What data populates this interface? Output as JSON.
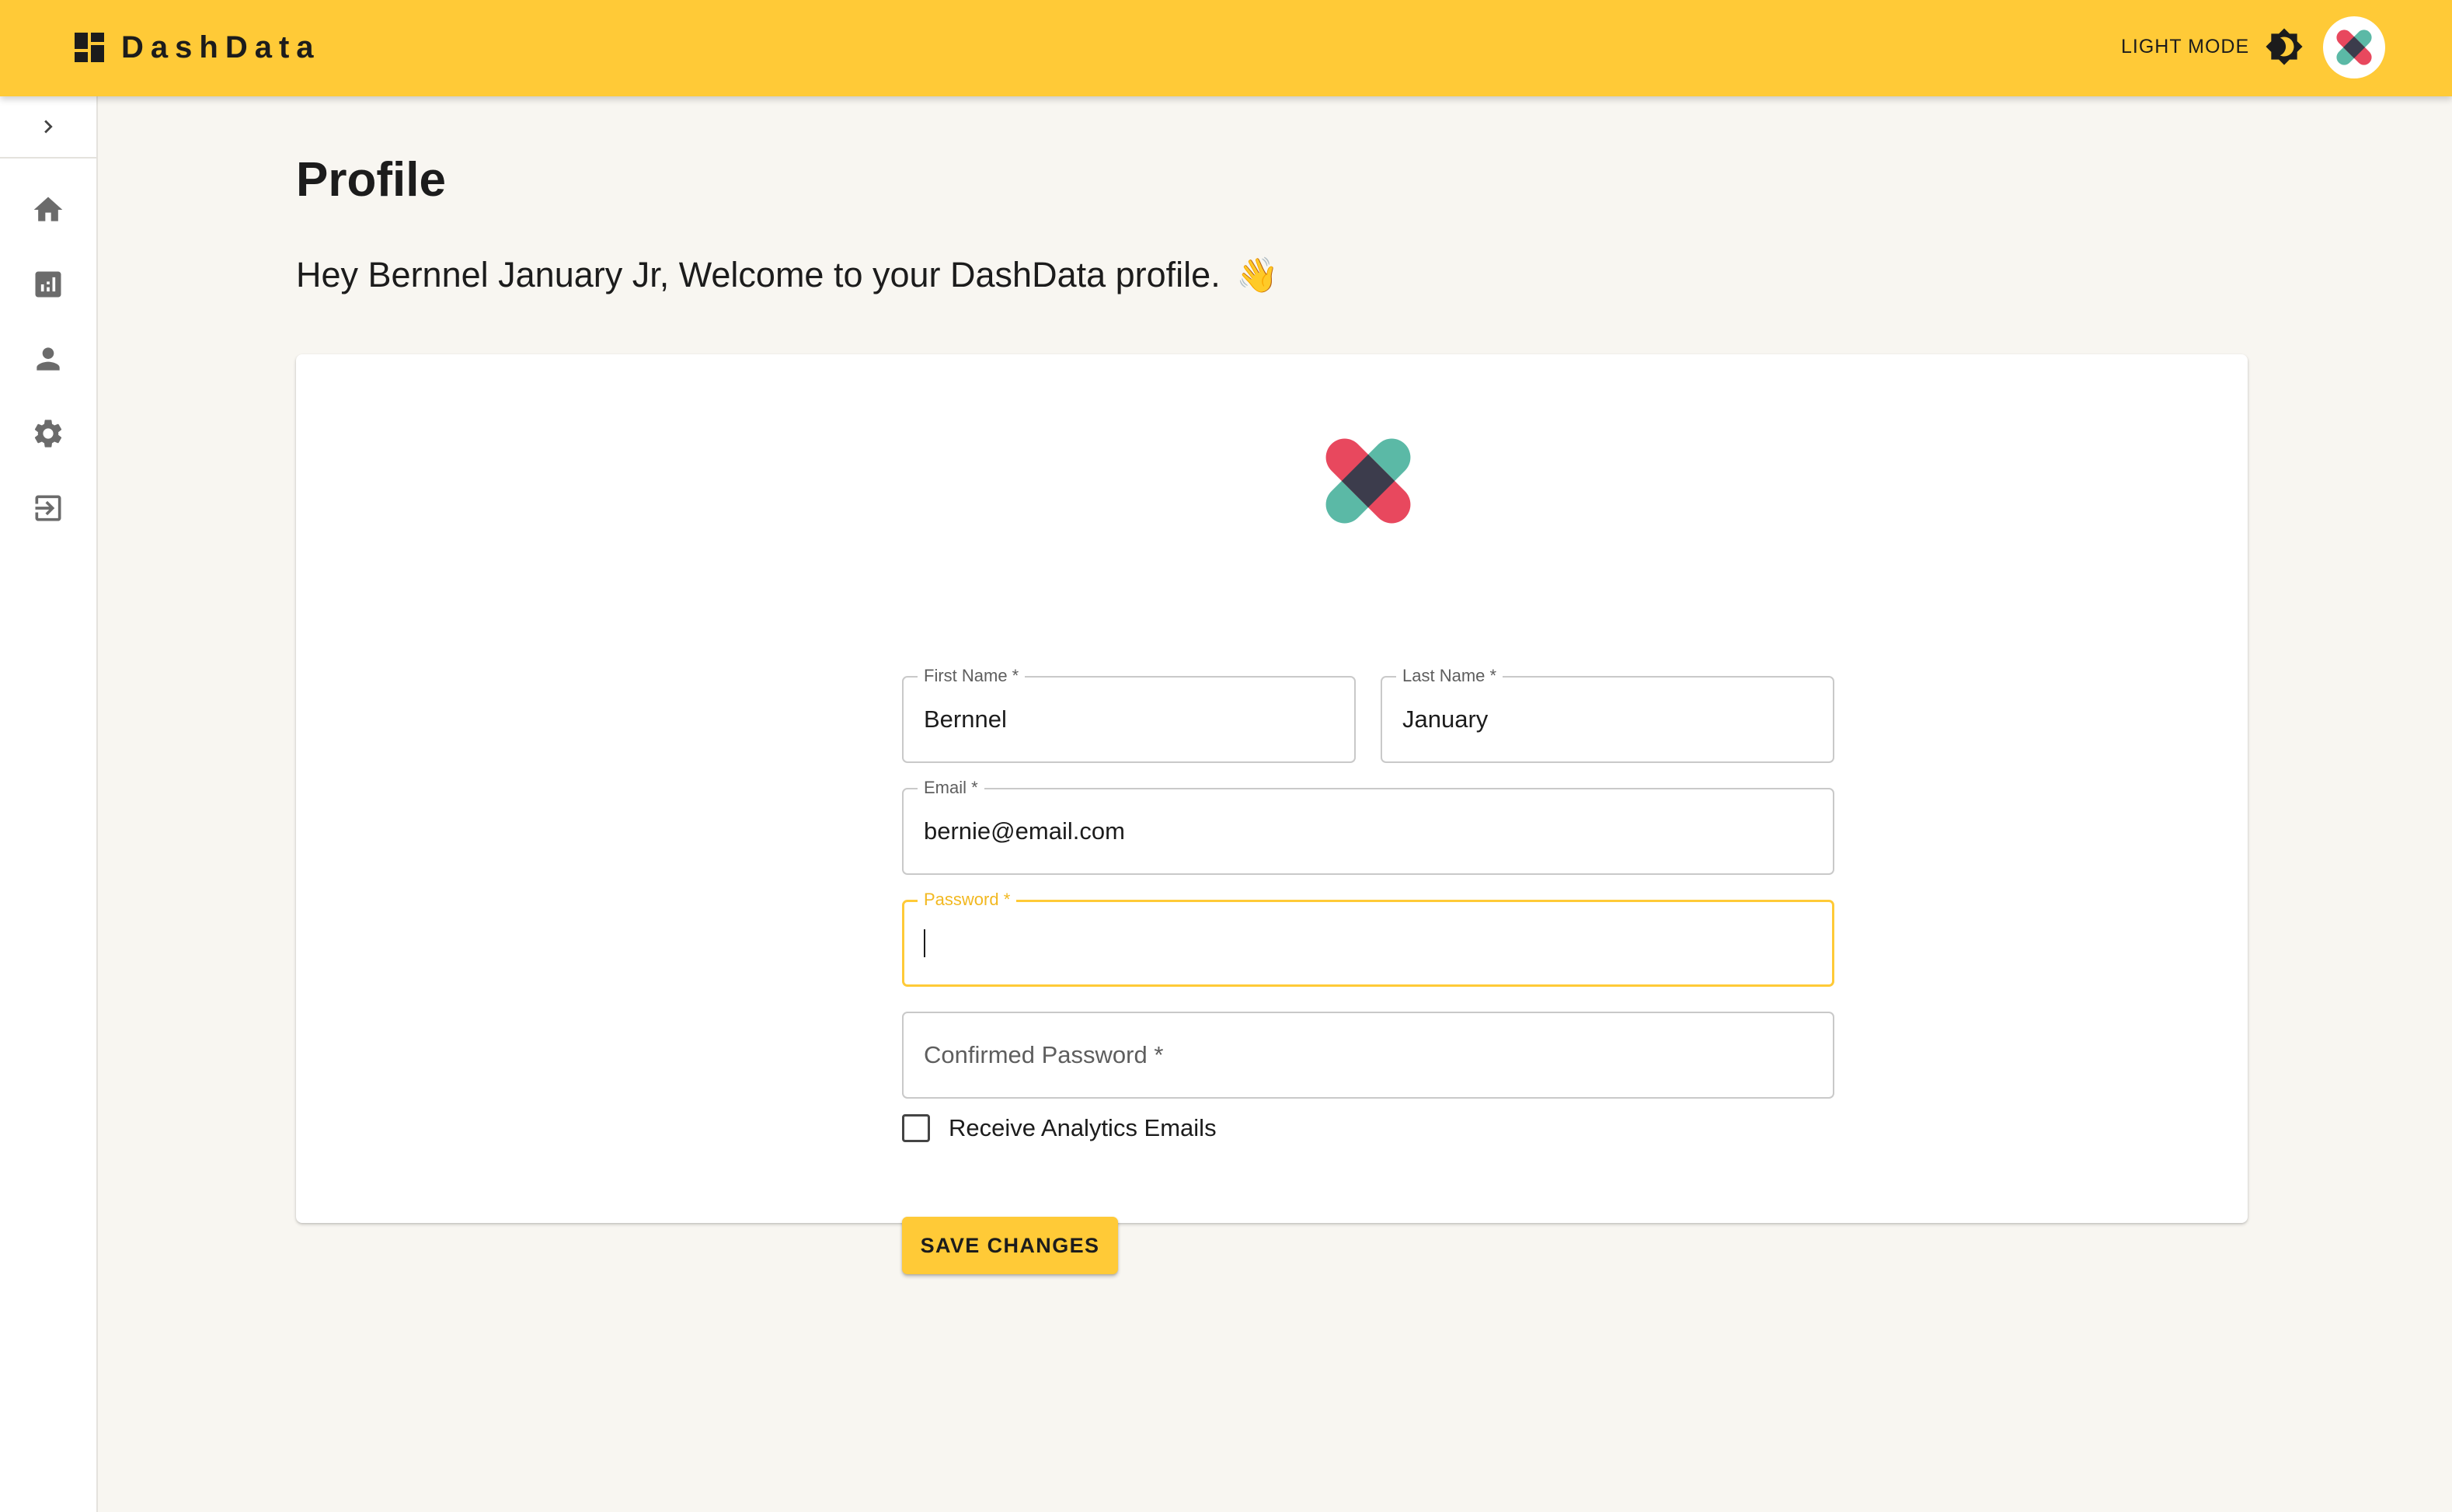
{
  "app": {
    "brand_name": "DashData",
    "mode_label": "LIGHT MODE",
    "icons": {
      "brand": "dashboard-icon",
      "mode": "brightness-icon",
      "avatar": "user-avatar-logo"
    }
  },
  "sidebar": {
    "toggle_icon": "chevron-right-icon",
    "items": [
      {
        "name": "home",
        "icon": "home-icon"
      },
      {
        "name": "analytics",
        "icon": "bar-chart-icon"
      },
      {
        "name": "profile",
        "icon": "person-icon"
      },
      {
        "name": "settings",
        "icon": "gear-icon"
      },
      {
        "name": "logout",
        "icon": "logout-icon"
      }
    ]
  },
  "page": {
    "title": "Profile",
    "welcome": "Hey Bernnel January Jr, Welcome to your DashData profile.",
    "welcome_emoji": "👋"
  },
  "form": {
    "first_name": {
      "label": "First Name *",
      "value": "Bernnel"
    },
    "last_name": {
      "label": "Last Name *",
      "value": "January"
    },
    "email": {
      "label": "Email *",
      "value": "bernie@email.com"
    },
    "password": {
      "label": "Password *",
      "value": ""
    },
    "confirm_password": {
      "placeholder": "Confirmed Password *",
      "value": ""
    },
    "analytics_checkbox": {
      "label": "Receive Analytics Emails",
      "checked": false
    },
    "save_label": "SAVE CHANGES"
  },
  "colors": {
    "accent": "#ffca37",
    "background": "#f8f6f1",
    "logo_red": "#e8485e",
    "logo_teal": "#5bb9a6",
    "logo_dark": "#3c3c4c"
  }
}
